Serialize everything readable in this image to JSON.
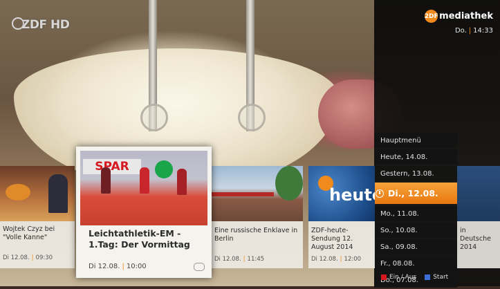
{
  "channel_logo": "ZDF HD",
  "header": {
    "brand": "mediathek",
    "brand_mark": "2DF",
    "day": "Do.",
    "time": "14:33",
    "accent": "#f08a1c"
  },
  "menu": {
    "items": [
      {
        "label": "Hauptmenü"
      },
      {
        "label": "Heute, 14.08."
      },
      {
        "label": "Gestern, 13.08."
      },
      {
        "label": "Di., 12.08.",
        "selected": true,
        "icon": "clock-icon"
      },
      {
        "label": "Mo., 11.08."
      },
      {
        "label": "So., 10.08."
      },
      {
        "label": "Sa., 09.08."
      },
      {
        "label": "Fr., 08.08."
      },
      {
        "label": "Do., 07.08."
      }
    ]
  },
  "keys": [
    {
      "color": "#d6181f",
      "label": "Ein / Aus"
    },
    {
      "color": "#3a6fd8",
      "label": "Start"
    }
  ],
  "cards": [
    {
      "caption": "Wojtek Czyz bei \"Volle Kanne\"",
      "date": "Di 12.08.",
      "time": "09:30"
    },
    {
      "caption": "Leichtathletik-EM - 1.Tag: Der Vormittag",
      "date": "Di 12.08.",
      "time": "10:00",
      "focused": true,
      "sign": "SPAR"
    },
    {
      "caption": "Eine russische Enklave in Berlin",
      "date": "Di 12.08.",
      "time": "11:45"
    },
    {
      "caption": "ZDF-heute-Sendung 12. August 2014",
      "date": "Di 12.08.",
      "time": "12:00",
      "thumb_text": "heute"
    },
    {
      "caption": "in Deutsche 2014",
      "date": "",
      "time": ""
    }
  ]
}
